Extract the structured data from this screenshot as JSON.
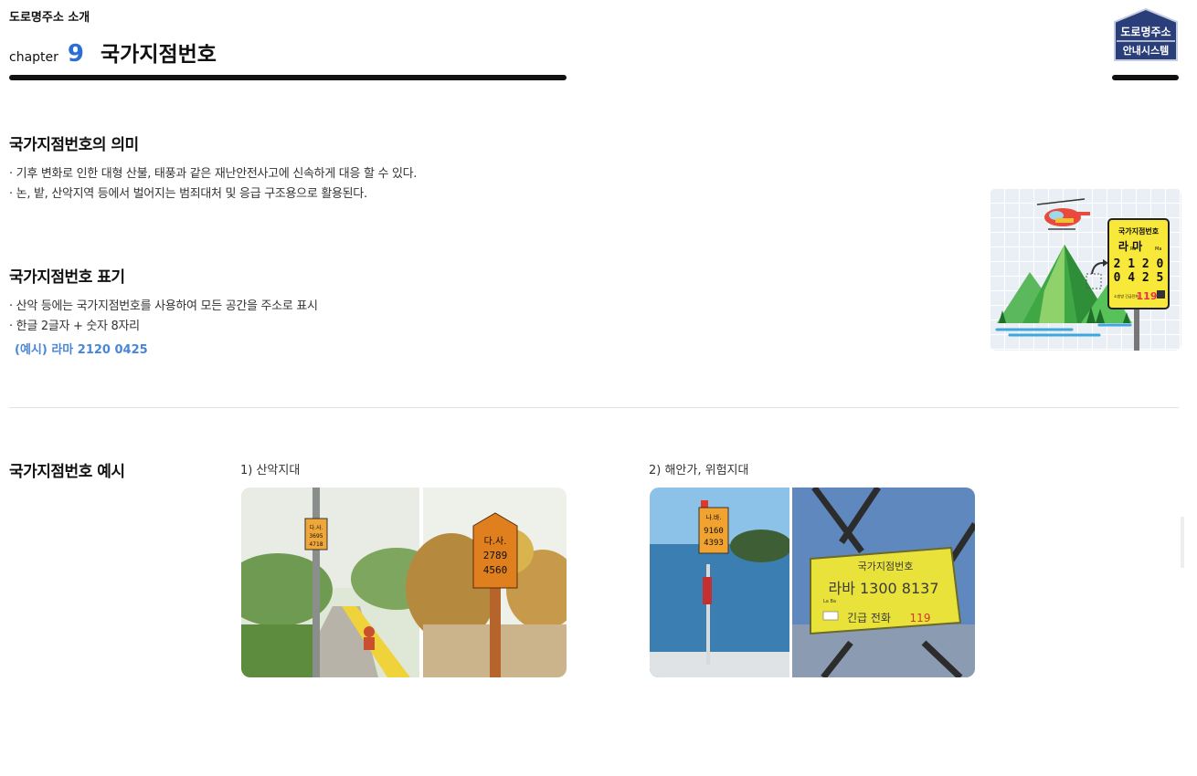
{
  "header": {
    "section_label": "도로명주소 소개",
    "chapter_word": "chapter",
    "chapter_number": "9",
    "chapter_title": "국가지점번호"
  },
  "logo": {
    "line1": "도로명주소",
    "line2": "안내시스템",
    "color": "#2a3f7a"
  },
  "meaning": {
    "title": "국가지점번호의 의미",
    "bullets": [
      "· 기후 변화로 인한 대형 산불, 태풍과 같은 재난안전사고에 신속하게 대응 할 수 있다.",
      "· 논, 밭, 산악지역 등에서 벌어지는 범죄대처 및 응급 구조용으로 활용된다."
    ]
  },
  "notation": {
    "title": "국가지점번호 표기",
    "bullets": [
      "· 산악 등에는 국가지점번호를 사용하여 모든 공간을 주소로 표시",
      "· 한글 2글자 + 숫자 8자리"
    ],
    "example": "(예시) 라마 2120 0425",
    "example_color": "#4a86d8"
  },
  "illustration": {
    "sign_title": "국가지점번호",
    "sign_code_hangul": "라 마",
    "sign_code_roman_1": "Ra",
    "sign_code_roman_2": "Ma",
    "sign_num1": "2 1 2 0",
    "sign_num2": "0 4 2 5",
    "sign_footer_small": "소방방 긴급전화",
    "sign_emergency": "119",
    "sign_color": "#f7e83a"
  },
  "examples": {
    "title": "국가지점번호 예시",
    "mountain": {
      "caption": "1) 산악지대",
      "photo1": {
        "line1": "다.사.",
        "line2": "3695",
        "line3": "4718"
      },
      "photo2": {
        "line1": "다.사.",
        "line2": "2789",
        "line3": "4560"
      }
    },
    "coast": {
      "caption": "2) 해안가, 위험지대",
      "photo1": {
        "line1": "나.바.",
        "line2": "9160",
        "line3": "4393"
      },
      "photo2": {
        "title": "국가지점번호",
        "code": "라바 1300 8137",
        "roman": "La    Ba",
        "emergency_label": "긴급 전화",
        "emergency_number": "119"
      }
    }
  }
}
